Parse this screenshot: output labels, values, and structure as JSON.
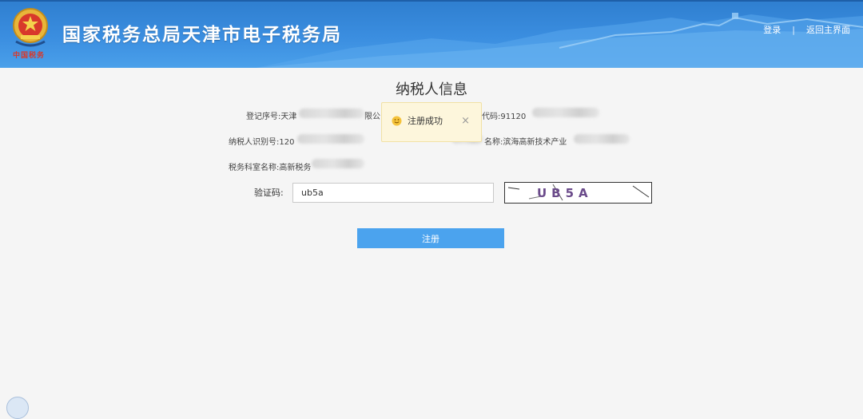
{
  "header": {
    "title": "国家税务总局天津市电子税务局",
    "login_link": "登录",
    "separator": "|",
    "home_link": "返回主界面",
    "emblem_caption": "中国税务"
  },
  "page": {
    "title": "纳税人信息"
  },
  "info": {
    "reg_no_label": "登记序号:天津",
    "reg_no_suffix": "限公",
    "credit_code_label": "代码:91120",
    "taxpayer_id_label": "纳税人识别号:120",
    "tax_office_label": "名称:滨海高新技术产业",
    "tax_section_label": "税务科室名称:高新税务"
  },
  "captcha": {
    "label": "验证码:",
    "value": "ub5a",
    "image_text": "UB5A"
  },
  "actions": {
    "register_label": "注册"
  },
  "toast": {
    "message": "注册成功",
    "close_glyph": "×"
  },
  "colors": {
    "header_blue": "#3b8ee0",
    "button_blue": "#4ba3ee",
    "toast_bg": "#fdf6dc",
    "toast_icon": "#f5c33b"
  }
}
